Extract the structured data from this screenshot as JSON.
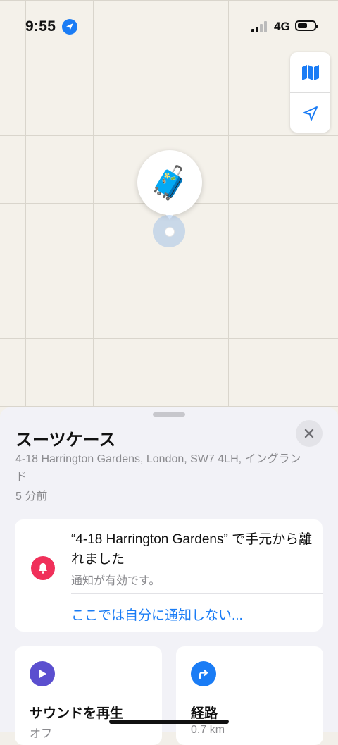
{
  "status": {
    "time": "9:55",
    "network": "4G"
  },
  "map": {
    "controls": [
      "map-icon",
      "location-arrow-icon"
    ],
    "item_emoji": "🧳"
  },
  "item": {
    "name": "スーツケース",
    "address": "4-18 Harrington Gardens, London, SW7 4LH, イングランド",
    "last_seen": "5 分前"
  },
  "alert": {
    "title": "“4-18 Harrington Gardens” で手元から離れました",
    "subtitle": "通知が有効です。",
    "link": "ここでは自分に通知しない..."
  },
  "actions": {
    "sound": {
      "label": "サウンドを再生",
      "sub": "オフ"
    },
    "directions": {
      "label": "経路",
      "sub": "0.7 km"
    }
  },
  "colors": {
    "accent": "#1a7cf5",
    "alert": "#f0305a",
    "sound_icon": "#5b4fcf"
  }
}
